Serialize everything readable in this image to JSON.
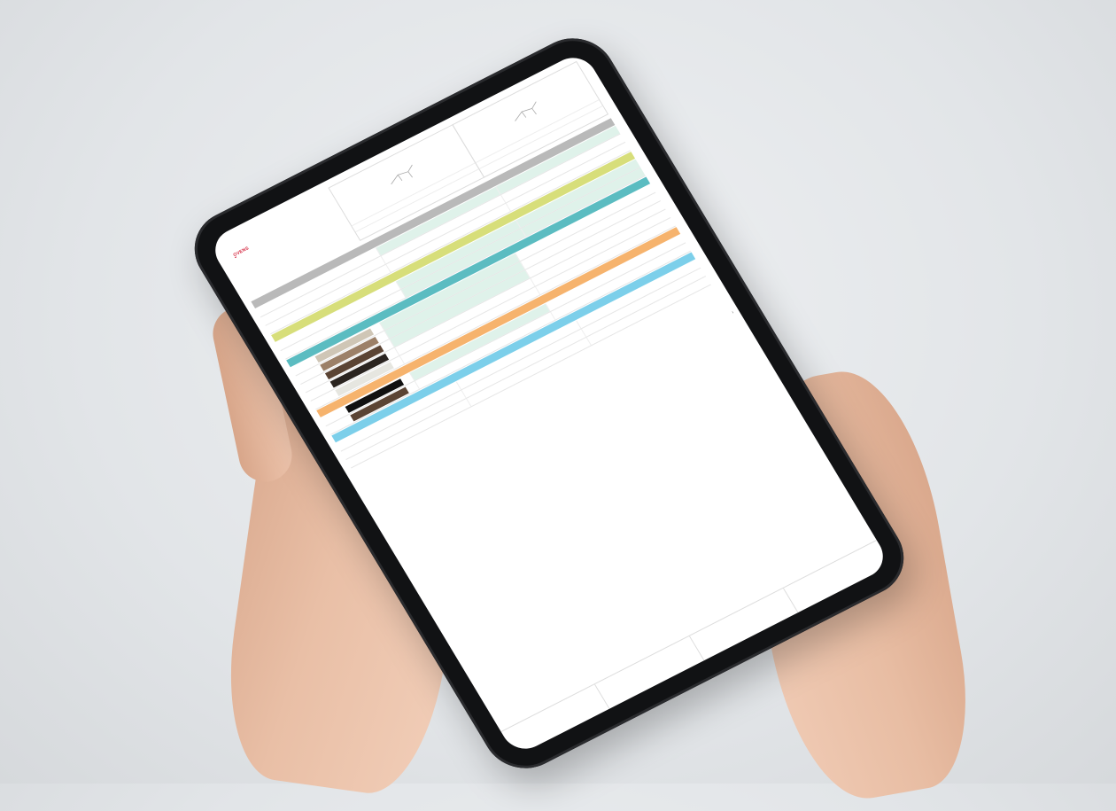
{
  "document": {
    "brand": "OVENS",
    "section": "",
    "title": "",
    "subtitle": "",
    "top_right": ""
  },
  "products": [
    {
      "dims": "",
      "model": "",
      "flag": ""
    },
    {
      "dims": "",
      "model": "",
      "flag": ""
    }
  ],
  "spec_rows": [
    {
      "label": "",
      "code": "",
      "band_before": "",
      "band_color": "#b9b9b9"
    },
    {
      "label": "",
      "code": "",
      "band_before": "",
      "band_color": "#d7de7a"
    },
    {
      "label": "",
      "code": "",
      "band_before": "",
      "band_color": "#5bbcc1"
    },
    {
      "label": "",
      "code": "",
      "band_before": "",
      "band_color": "#f6b36d"
    },
    {
      "label": "",
      "code": "",
      "band_before": "",
      "band_color": "#7ccfea"
    }
  ],
  "band_colors": {
    "grey": "#b9b9b9",
    "lime": "#d7de7a",
    "teal": "#5bbcc1",
    "orange": "#f6b36d",
    "sky": "#7ccfea",
    "accent": "#d3203a"
  },
  "swatches": [
    "#cfc6b6",
    "#9c8068",
    "#5b4434",
    "#2a2420",
    "#e6e6e0",
    "#111111"
  ],
  "bottom_tabs": [
    {
      "label": ""
    },
    {
      "label": ""
    },
    {
      "label": ""
    },
    {
      "label": ""
    }
  ]
}
